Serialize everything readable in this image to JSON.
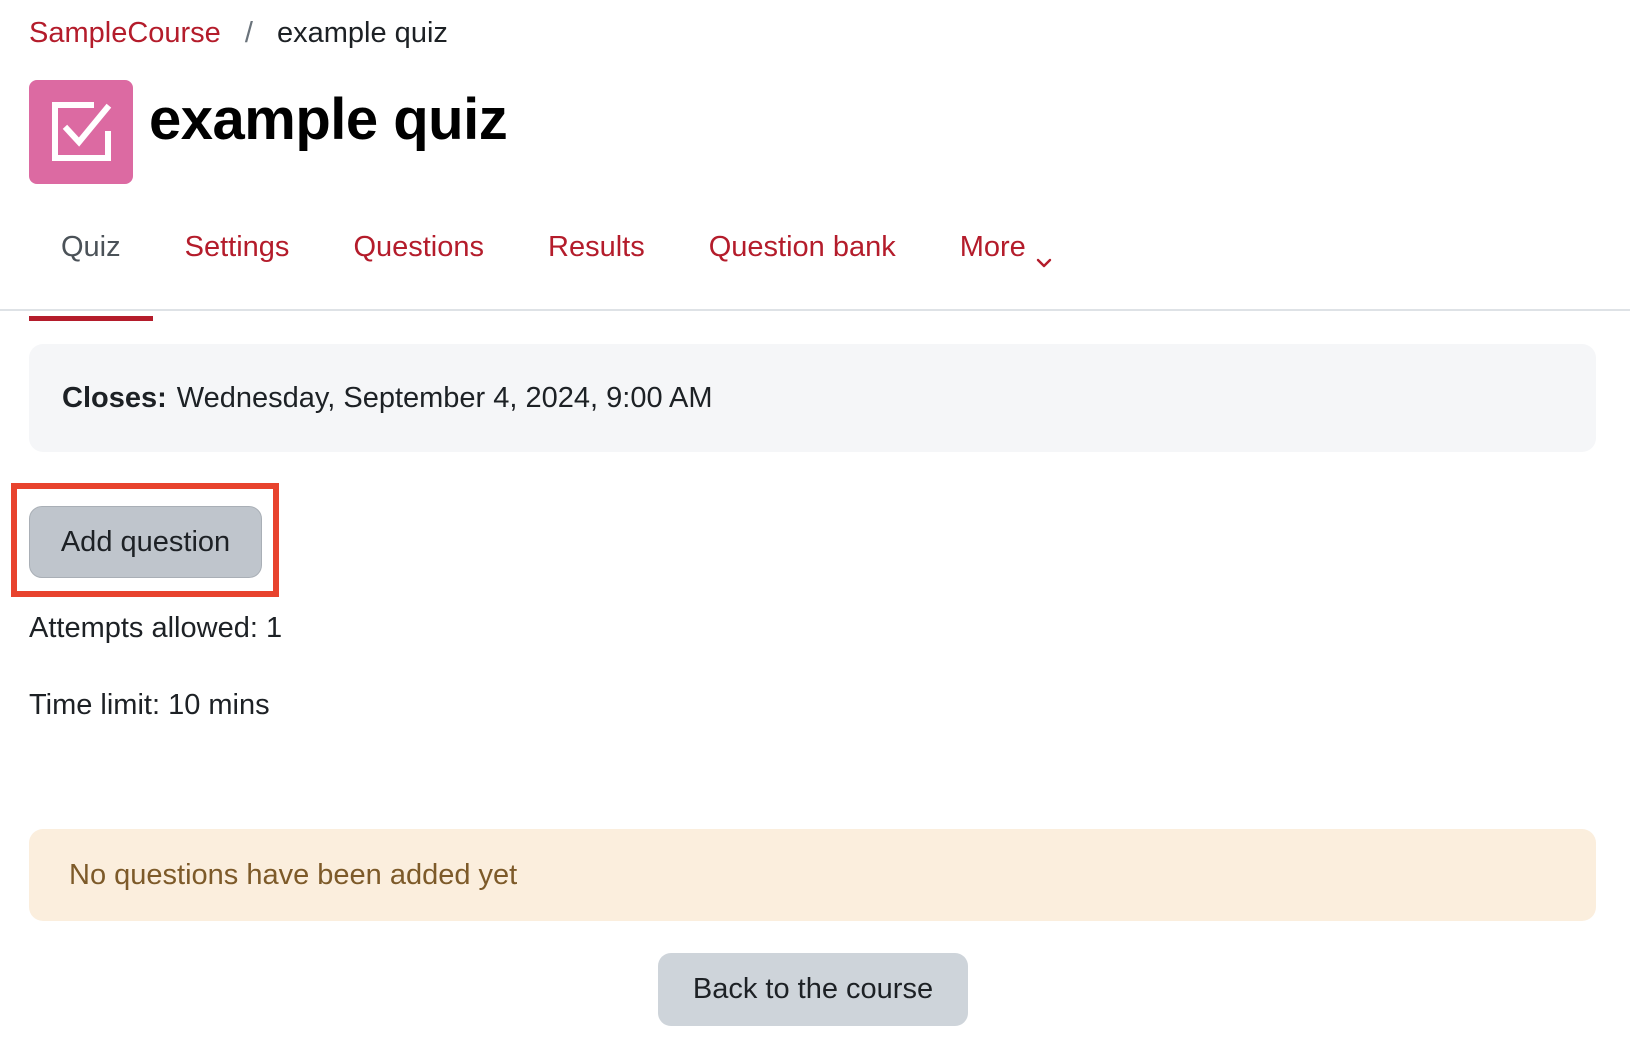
{
  "breadcrumb": {
    "course": "SampleCourse",
    "separator": "/",
    "current": "example quiz"
  },
  "header": {
    "icon": "quiz-checkbox-icon",
    "icon_color": "#dc6aa2",
    "title": "example quiz"
  },
  "tabs": [
    {
      "label": "Quiz",
      "active": true
    },
    {
      "label": "Settings",
      "active": false
    },
    {
      "label": "Questions",
      "active": false
    },
    {
      "label": "Results",
      "active": false
    },
    {
      "label": "Question bank",
      "active": false
    },
    {
      "label": "More",
      "active": false,
      "icon": "chevron-down-icon"
    }
  ],
  "dates": {
    "closes_label": "Closes:",
    "closes_value": "Wednesday, September 4, 2024, 9:00 AM"
  },
  "actions": {
    "add_question": "Add question",
    "back_to_course": "Back to the course"
  },
  "info": {
    "attempts": "Attempts allowed: 1",
    "time_limit": "Time limit: 10 mins"
  },
  "notice": {
    "text": "No questions have been added yet"
  },
  "colors": {
    "accent": "#b41c2b",
    "highlight": "#e8432d",
    "notice_bg": "#fbeedd",
    "notice_text": "#7d5a29"
  }
}
